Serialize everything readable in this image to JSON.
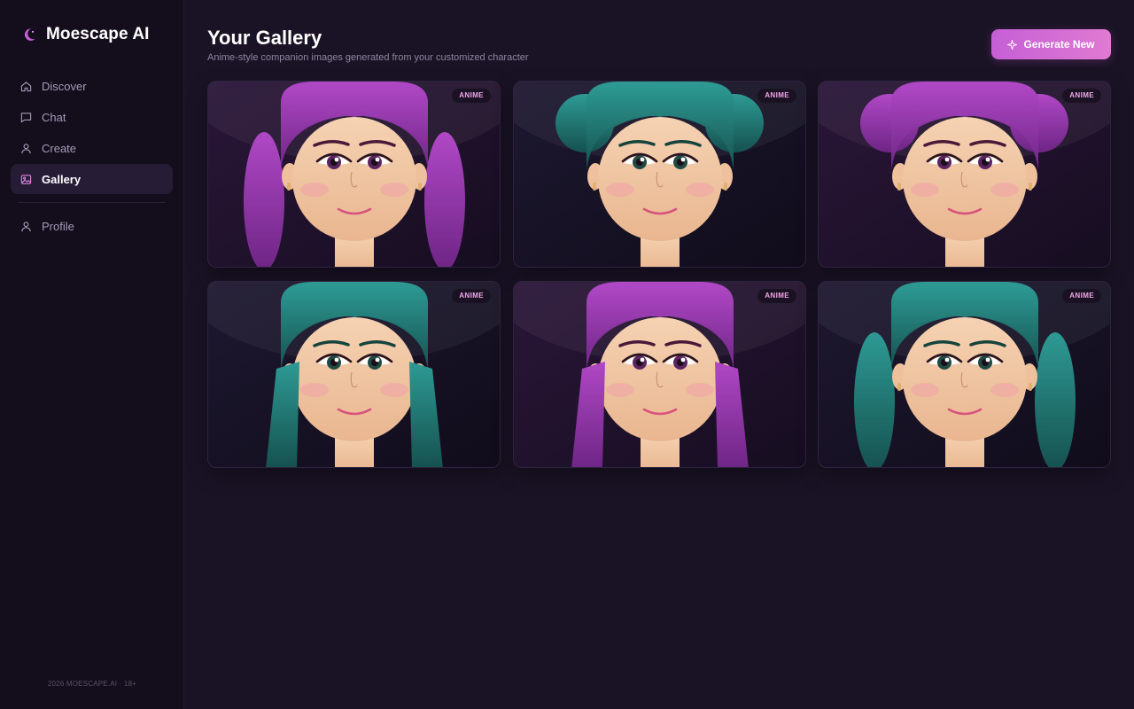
{
  "app": {
    "name": "Moescape AI",
    "logo_icon": "crescent-moon-icon",
    "accent": "#c55fd6"
  },
  "sidebar": {
    "items": [
      {
        "label": "Discover",
        "icon": "home-icon",
        "active": false
      },
      {
        "label": "Chat",
        "icon": "chat-bubble-icon",
        "active": false
      },
      {
        "label": "Create",
        "icon": "user-icon",
        "active": false
      },
      {
        "label": "Gallery",
        "icon": "image-icon",
        "active": true
      }
    ],
    "secondary": [
      {
        "label": "Profile",
        "icon": "user-icon",
        "active": false
      }
    ],
    "footer": "2026 MOESCAPE.AI · 18+"
  },
  "header": {
    "title": "Your Gallery",
    "subtitle": "Anime-style companion images generated from your customized character",
    "generate_label": "Generate New",
    "generate_icon": "sparkle-icon"
  },
  "gallery": {
    "items": [
      {
        "badge": "ANIME",
        "hair": "purple",
        "style": "long-side",
        "eyes": "purple"
      },
      {
        "badge": "ANIME",
        "hair": "teal",
        "style": "buns",
        "eyes": "teal"
      },
      {
        "badge": "ANIME",
        "hair": "purple",
        "style": "buns",
        "eyes": "purple"
      },
      {
        "badge": "ANIME",
        "hair": "teal",
        "style": "straight",
        "eyes": "teal"
      },
      {
        "badge": "ANIME",
        "hair": "purple",
        "style": "straight",
        "eyes": "purple"
      },
      {
        "badge": "ANIME",
        "hair": "teal",
        "style": "long-side",
        "eyes": "teal"
      }
    ]
  },
  "colors": {
    "purple_hair": "#9b3db5",
    "teal_hair": "#1f7a76",
    "skin": "#f1c9a5",
    "blush": "#f0a0a8",
    "lips": "#d8527e"
  }
}
